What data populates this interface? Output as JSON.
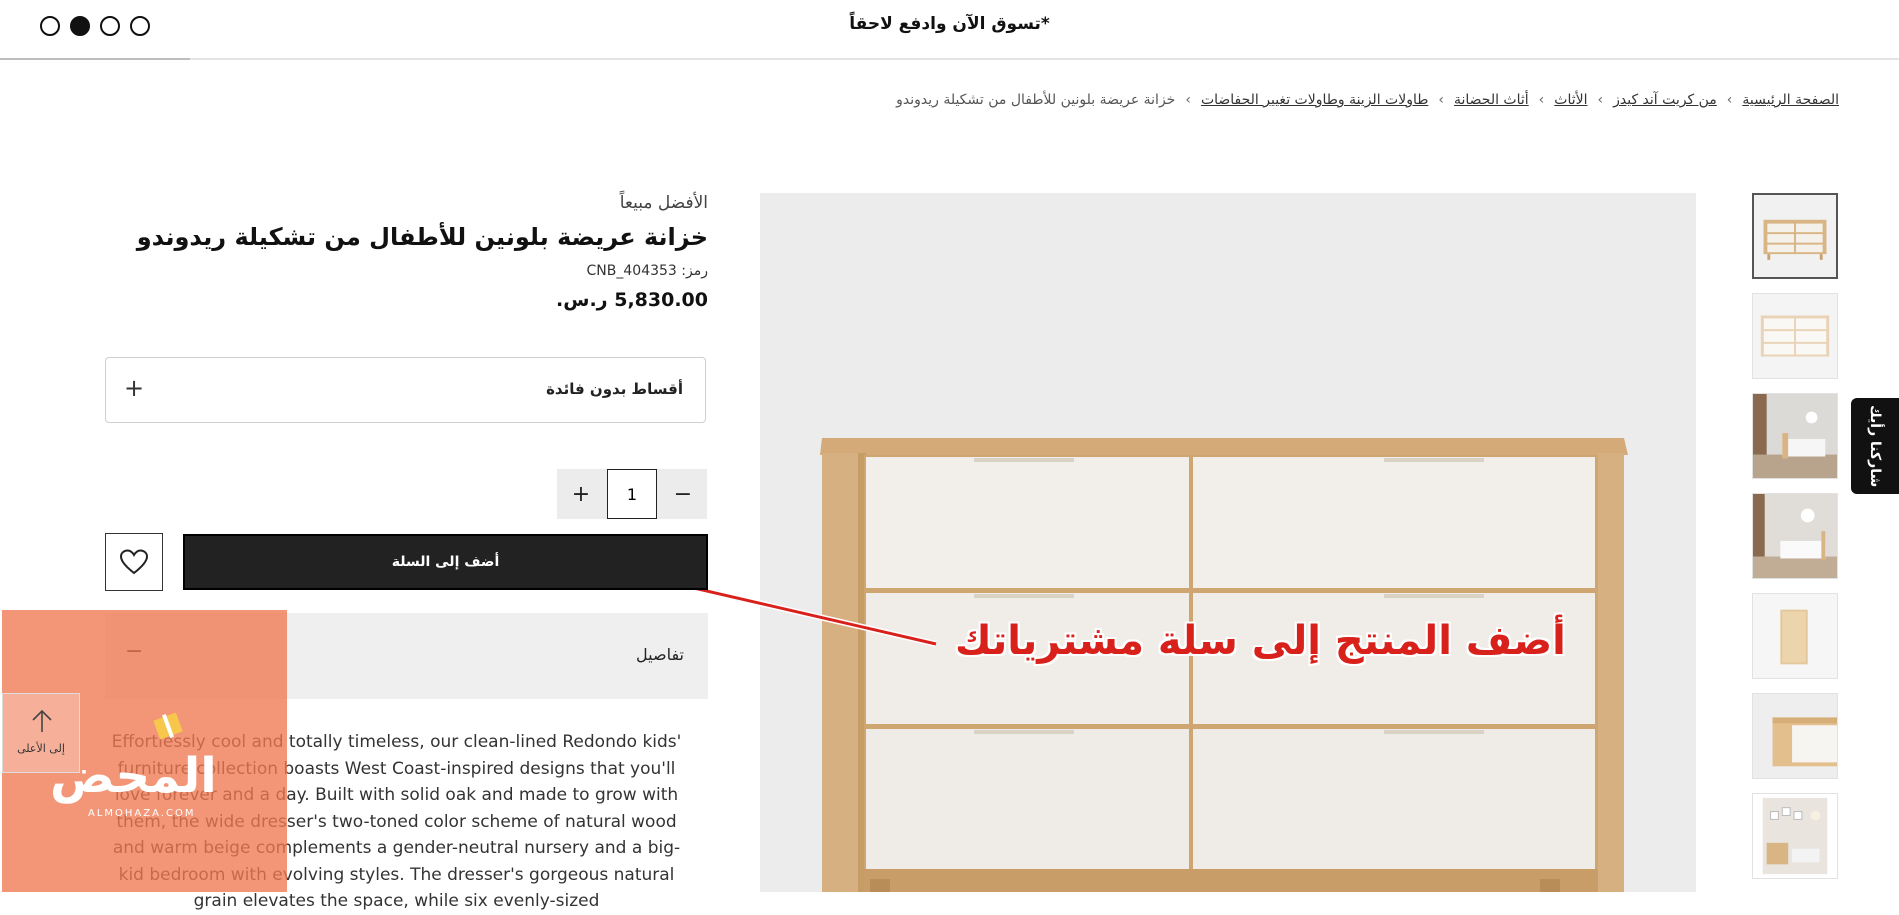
{
  "promo": {
    "text": "تسوق الآن وادفع لاحقاً*",
    "dots": 4,
    "active_dot": 1
  },
  "breadcrumb": {
    "items": [
      "الصفحة الرئيسية",
      "من كريت آند كيدز",
      "الأثاث",
      "أثاث الحضانة",
      "طاولات الزينة وطاولات تغيير الحفاضات"
    ],
    "current": "خزانة عريضة بلونين للأطفال من تشكيلة ريدوندو"
  },
  "product": {
    "badge": "الأفضل مبيعاً",
    "title": "خزانة عريضة بلونين للأطفال من تشكيلة ريدوندو",
    "sku_label": "رمز:",
    "sku": "404353_CNB",
    "price": "5,830.00",
    "currency": "ر.س.",
    "installments_label": "أقساط بدون فائدة",
    "quantity": "1",
    "add_to_cart_label": "أضف إلى السلة",
    "details_label": "تفاصيل",
    "description": "Effortlessly cool and totally timeless, our clean-lined Redondo kids' furniture collection boasts West Coast-inspired designs that you'll love forever and a day. Built with solid oak and made to grow with them, the wide dresser's two-toned color scheme of natural wood and warm beige complements a gender-neutral nursery and a big-kid bedroom with evolving styles. The dresser's gorgeous natural grain elevates the space, while six evenly-sized"
  },
  "gallery": {
    "thumbnails": [
      "dresser-front",
      "dresser-front-white",
      "bedroom-scene",
      "bedroom-scene-2",
      "dresser-side",
      "dresser-corner-detail",
      "nursery-room"
    ],
    "active_index": 0
  },
  "feedback": {
    "label": "شاركنا رأيك"
  },
  "annotation": {
    "text": "أضف المنتج إلى سلة مشترياتك",
    "color": "#d9211c"
  },
  "watermark": {
    "logo": "المحض",
    "subtitle": "ALMOHAZA.COM"
  },
  "back_to_top": {
    "label": "إلى الأعلى"
  },
  "colors": {
    "accent": "#222222",
    "annotation": "#d9211c",
    "watermark": "#f07852"
  }
}
